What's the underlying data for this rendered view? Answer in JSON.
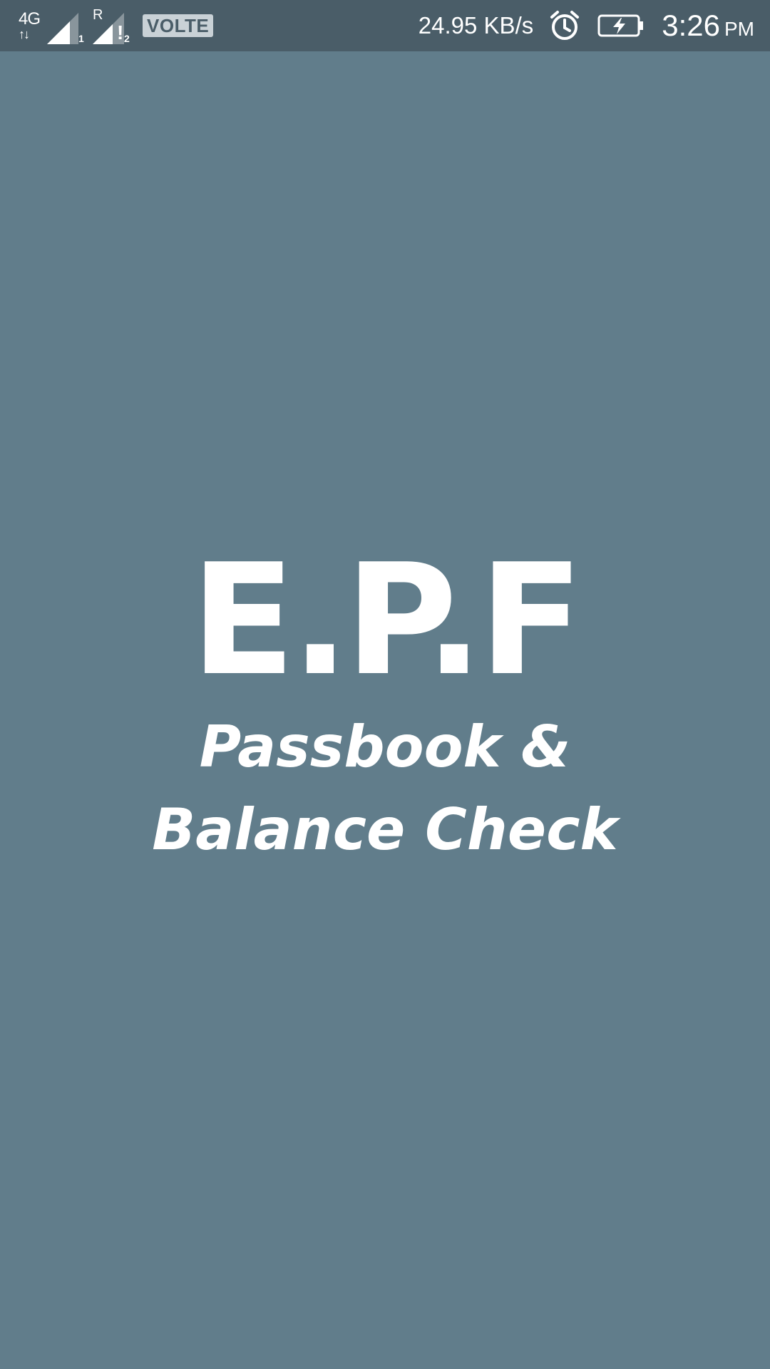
{
  "status_bar": {
    "network_type": "4G",
    "network_arrows": "↑↓",
    "sim1_label": "1",
    "roaming_label": "R",
    "warning_label": "!",
    "sim2_label": "2",
    "volte_label": "VOLTE",
    "speed": "24.95 KB/s",
    "time": "3:26",
    "ampm": "PM",
    "icons": [
      "signal-icon",
      "alarm-icon",
      "battery-charging-icon"
    ]
  },
  "splash": {
    "title": "E.P.F",
    "subtitle_line1": "Passbook &",
    "subtitle_line2": "Balance Check"
  },
  "colors": {
    "background": "#617d8b",
    "status_bar": "#4a5d68",
    "text": "#ffffff"
  }
}
